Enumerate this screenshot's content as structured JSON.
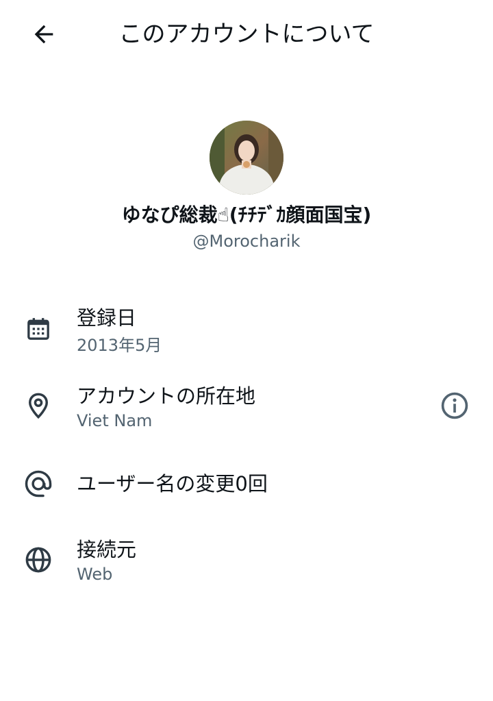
{
  "header": {
    "title": "このアカウントについて",
    "back_icon": "arrow-left-icon"
  },
  "profile": {
    "display_name": "ゆなぴ総裁☝(ﾁﾁﾃﾞｶ顔面国宝)",
    "handle": "@Morocharik"
  },
  "details": [
    {
      "icon": "calendar-icon",
      "title": "登録日",
      "subtitle": "2013年5月"
    },
    {
      "icon": "location-pin-icon",
      "title": "アカウントの所在地",
      "subtitle": "Viet Nam",
      "action_icon": "info-icon"
    },
    {
      "icon": "at-sign-icon",
      "title": "ユーザー名の変更0回"
    },
    {
      "icon": "globe-icon",
      "title": "接続元",
      "subtitle": "Web"
    }
  ],
  "colors": {
    "text_primary": "#0f1419",
    "text_secondary": "#536471",
    "icon": "#2f3b45"
  }
}
